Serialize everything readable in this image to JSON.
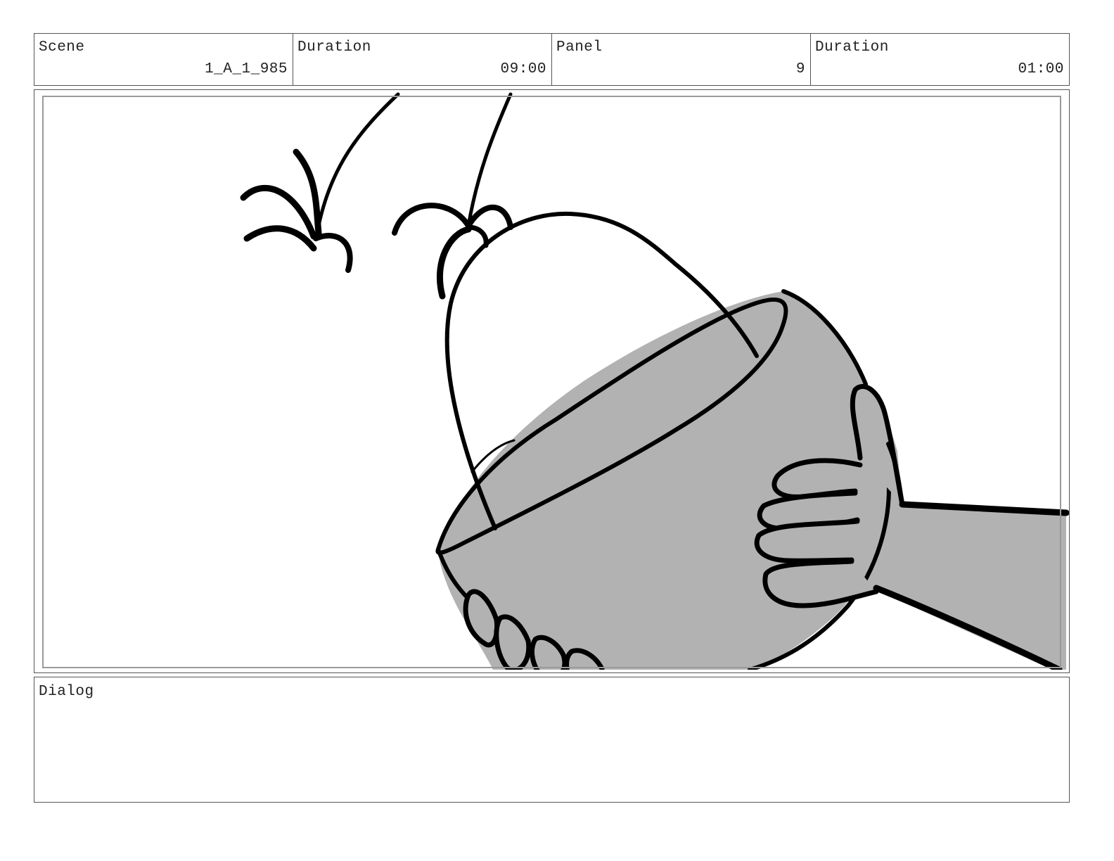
{
  "header": {
    "scene_label": "Scene",
    "scene_value": "1_A_1_985",
    "duration_label": "Duration",
    "duration_value": "09:00",
    "panel_label": "Panel",
    "panel_value": "9",
    "panel_duration_label": "Duration",
    "panel_duration_value": "01:00"
  },
  "dialog": {
    "label": "Dialog",
    "text": ""
  },
  "colors": {
    "ink": "#000000",
    "fill": "#b2b2b2",
    "border": "#555555",
    "safe_frame": "#9a9a9a"
  }
}
